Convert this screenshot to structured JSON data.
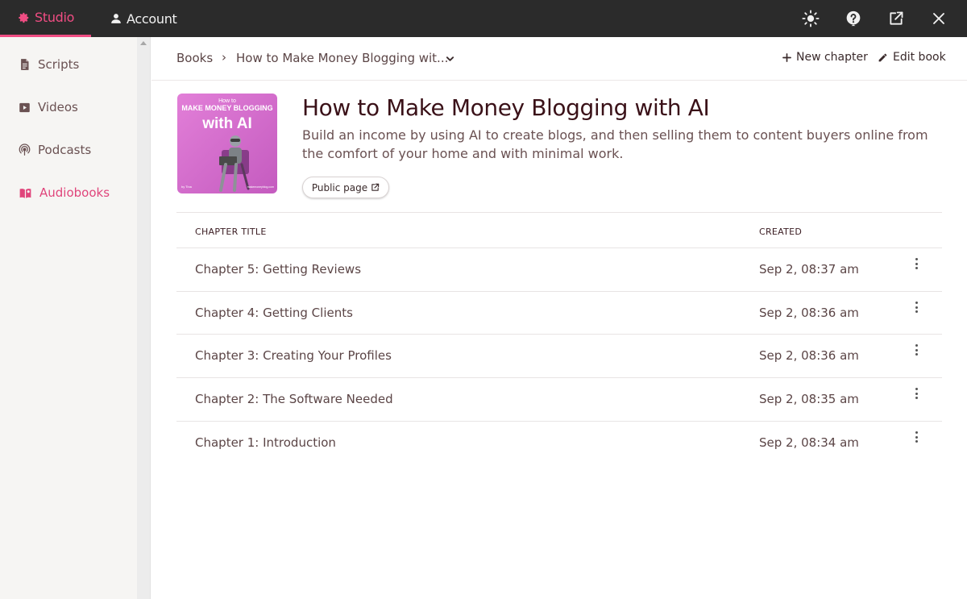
{
  "topbar": {
    "tabs": [
      {
        "label": "Studio",
        "icon": "gear-icon",
        "active": true
      },
      {
        "label": "Account",
        "icon": "person-icon",
        "active": false
      }
    ],
    "icons": [
      "brightness-icon",
      "help-icon",
      "open-external-icon",
      "close-icon"
    ],
    "accent": "#f04d83"
  },
  "sidebar": {
    "items": [
      {
        "label": "Scripts",
        "icon": "document-icon",
        "active": false
      },
      {
        "label": "Videos",
        "icon": "video-icon",
        "active": false
      },
      {
        "label": "Podcasts",
        "icon": "podcast-icon",
        "active": false
      },
      {
        "label": "Audiobooks",
        "icon": "book-icon",
        "active": true
      }
    ]
  },
  "breadcrumb": {
    "root": "Books",
    "separator": "›",
    "current": "How to Make Money Blogging wit..."
  },
  "actions": {
    "new_chapter": "New chapter",
    "edit_book": "Edit book"
  },
  "book": {
    "title": "How to Make Money Blogging with AI",
    "description": "Build an income by using AI to create blogs, and then selling them to content buyers online from the comfort of your home and with minimal work.",
    "public_page_label": "Public page",
    "cover": {
      "line1": "How to",
      "line2": "MAKE MONEY BLOGGING",
      "line3": "with AI",
      "author": "by Tina",
      "site": "makemoneyblog.com"
    }
  },
  "table": {
    "headers": {
      "title": "CHAPTER TITLE",
      "created": "CREATED"
    },
    "rows": [
      {
        "title": "Chapter 5: Getting Reviews",
        "created": "Sep 2, 08:37 am"
      },
      {
        "title": "Chapter 4: Getting Clients",
        "created": "Sep 2, 08:36 am"
      },
      {
        "title": "Chapter 3: Creating Your Profiles",
        "created": "Sep 2, 08:36 am"
      },
      {
        "title": "Chapter 2: The Software Needed",
        "created": "Sep 2, 08:35 am"
      },
      {
        "title": "Chapter 1: Introduction",
        "created": "Sep 2, 08:34 am"
      }
    ]
  }
}
